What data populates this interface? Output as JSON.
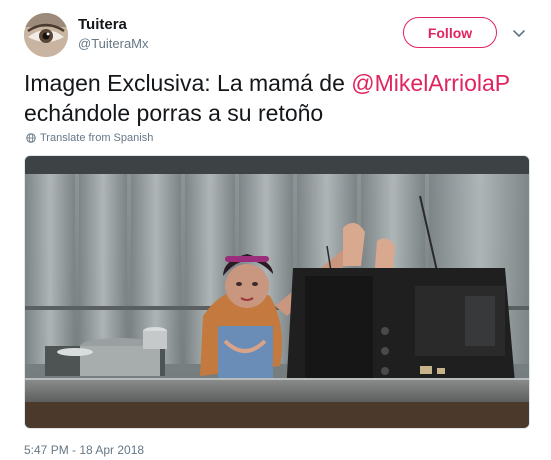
{
  "user": {
    "display_name": "Tuitera",
    "handle": "@TuiteraMx",
    "avatar_icon": "avatar-eye-photo"
  },
  "follow_button": {
    "label": "Follow"
  },
  "menu": {
    "icon": "chevron-down-icon"
  },
  "tweet": {
    "text_prefix": "Imagen Exclusiva: La mamá de ",
    "mention": "@MikelArriolaP",
    "text_suffix": " echándole porras a su retoño"
  },
  "translate": {
    "label": "Translate from Spanish",
    "icon": "globe-icon"
  },
  "media": {
    "alt": "photo-kitchen-scene"
  },
  "timestamp": "5:47 PM - 18 Apr 2018",
  "colors": {
    "accent": "#e0245e",
    "secondary_text": "#657786",
    "primary_text": "#14171a"
  }
}
